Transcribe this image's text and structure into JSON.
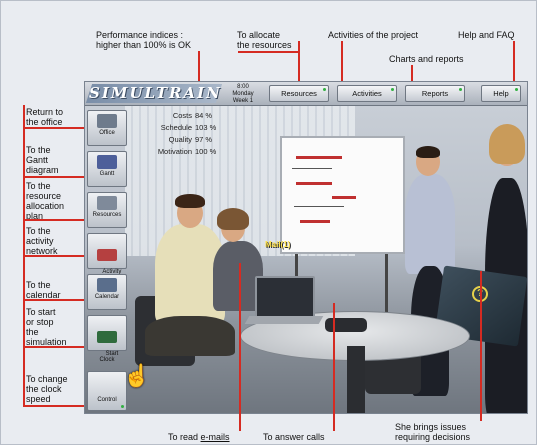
{
  "annotations": {
    "performance_indices": "Performance indices :\nhigher than 100% is OK",
    "to_allocate": "To allocate\nthe resources",
    "activities_of_project": "Activities of the project",
    "help_and_faq": "Help and FAQ",
    "charts_and_reports": "Charts and reports",
    "return_office": "Return to\nthe office",
    "to_gantt": "To the\nGantt\ndiagram",
    "to_resource_plan": "To the\nresource\nallocation\nplan",
    "to_activity_network": "To the\nactivity\nnetwork",
    "to_calendar": "To the\ncalendar",
    "start_stop": "To start\nor stop\nthe\nsimulation",
    "change_clock": "To change\nthe clock\nspeed",
    "read_emails_prefix": "To read ",
    "read_emails_link": "e-mails",
    "answer_calls": "To answer calls",
    "brings_issues": "She brings issues\nrequiring decisions"
  },
  "app": {
    "logo": "SIMULTRAIN",
    "clock": {
      "time": "8:00",
      "day": "Monday",
      "week": "Week 1"
    },
    "top_buttons": [
      {
        "label": "Resources"
      },
      {
        "label": "Activities"
      },
      {
        "label": "Reports"
      },
      {
        "label": "Help"
      }
    ],
    "indices": [
      {
        "label": "Costs",
        "value": "84 %"
      },
      {
        "label": "Schedule",
        "value": "103 %"
      },
      {
        "label": "Quality",
        "value": "97 %"
      },
      {
        "label": "Motivation",
        "value": "100 %"
      }
    ],
    "left_buttons": [
      {
        "label": "Office",
        "icon": "office-icon",
        "color": "#6e7b8c"
      },
      {
        "label": "Gantt",
        "icon": "gantt-icon",
        "color": "#4d5f9a"
      },
      {
        "label": "Resources",
        "icon": "resources-icon",
        "color": "#7f8a9a"
      },
      {
        "label": "Activity\nNetwork",
        "icon": "network-icon",
        "color": "#b54040"
      },
      {
        "label": "Calendar",
        "icon": "calendar-icon",
        "color": "#5a6e8c"
      },
      {
        "label": "Start\nClock",
        "icon": "play-icon",
        "color": "#2f6b3d"
      },
      {
        "label": "Control",
        "icon": "control-icon",
        "color": "#8d96a3"
      }
    ],
    "mail_tag": "Mail(1)",
    "question_badge": "?"
  }
}
